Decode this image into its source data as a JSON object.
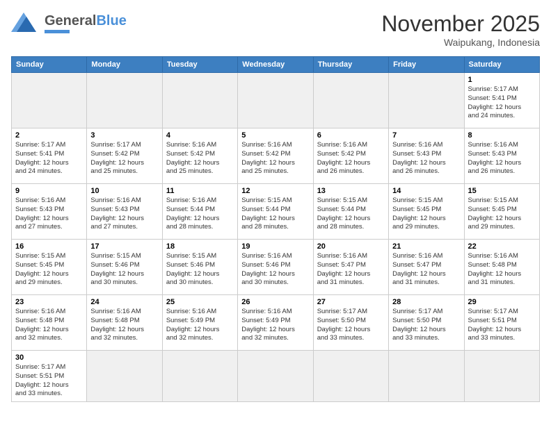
{
  "logo": {
    "text_general": "General",
    "text_blue": "Blue"
  },
  "header": {
    "month": "November 2025",
    "location": "Waipukang, Indonesia"
  },
  "days_of_week": [
    "Sunday",
    "Monday",
    "Tuesday",
    "Wednesday",
    "Thursday",
    "Friday",
    "Saturday"
  ],
  "weeks": [
    [
      {
        "day": "",
        "info": "",
        "empty": true
      },
      {
        "day": "",
        "info": "",
        "empty": true
      },
      {
        "day": "",
        "info": "",
        "empty": true
      },
      {
        "day": "",
        "info": "",
        "empty": true
      },
      {
        "day": "",
        "info": "",
        "empty": true
      },
      {
        "day": "",
        "info": "",
        "empty": true
      },
      {
        "day": "1",
        "info": "Sunrise: 5:17 AM\nSunset: 5:41 PM\nDaylight: 12 hours\nand 24 minutes."
      }
    ],
    [
      {
        "day": "2",
        "info": "Sunrise: 5:17 AM\nSunset: 5:41 PM\nDaylight: 12 hours\nand 24 minutes."
      },
      {
        "day": "3",
        "info": "Sunrise: 5:17 AM\nSunset: 5:42 PM\nDaylight: 12 hours\nand 25 minutes."
      },
      {
        "day": "4",
        "info": "Sunrise: 5:16 AM\nSunset: 5:42 PM\nDaylight: 12 hours\nand 25 minutes."
      },
      {
        "day": "5",
        "info": "Sunrise: 5:16 AM\nSunset: 5:42 PM\nDaylight: 12 hours\nand 25 minutes."
      },
      {
        "day": "6",
        "info": "Sunrise: 5:16 AM\nSunset: 5:42 PM\nDaylight: 12 hours\nand 26 minutes."
      },
      {
        "day": "7",
        "info": "Sunrise: 5:16 AM\nSunset: 5:43 PM\nDaylight: 12 hours\nand 26 minutes."
      },
      {
        "day": "8",
        "info": "Sunrise: 5:16 AM\nSunset: 5:43 PM\nDaylight: 12 hours\nand 26 minutes."
      }
    ],
    [
      {
        "day": "9",
        "info": "Sunrise: 5:16 AM\nSunset: 5:43 PM\nDaylight: 12 hours\nand 27 minutes."
      },
      {
        "day": "10",
        "info": "Sunrise: 5:16 AM\nSunset: 5:43 PM\nDaylight: 12 hours\nand 27 minutes."
      },
      {
        "day": "11",
        "info": "Sunrise: 5:16 AM\nSunset: 5:44 PM\nDaylight: 12 hours\nand 28 minutes."
      },
      {
        "day": "12",
        "info": "Sunrise: 5:15 AM\nSunset: 5:44 PM\nDaylight: 12 hours\nand 28 minutes."
      },
      {
        "day": "13",
        "info": "Sunrise: 5:15 AM\nSunset: 5:44 PM\nDaylight: 12 hours\nand 28 minutes."
      },
      {
        "day": "14",
        "info": "Sunrise: 5:15 AM\nSunset: 5:45 PM\nDaylight: 12 hours\nand 29 minutes."
      },
      {
        "day": "15",
        "info": "Sunrise: 5:15 AM\nSunset: 5:45 PM\nDaylight: 12 hours\nand 29 minutes."
      }
    ],
    [
      {
        "day": "16",
        "info": "Sunrise: 5:15 AM\nSunset: 5:45 PM\nDaylight: 12 hours\nand 29 minutes."
      },
      {
        "day": "17",
        "info": "Sunrise: 5:15 AM\nSunset: 5:46 PM\nDaylight: 12 hours\nand 30 minutes."
      },
      {
        "day": "18",
        "info": "Sunrise: 5:15 AM\nSunset: 5:46 PM\nDaylight: 12 hours\nand 30 minutes."
      },
      {
        "day": "19",
        "info": "Sunrise: 5:16 AM\nSunset: 5:46 PM\nDaylight: 12 hours\nand 30 minutes."
      },
      {
        "day": "20",
        "info": "Sunrise: 5:16 AM\nSunset: 5:47 PM\nDaylight: 12 hours\nand 31 minutes."
      },
      {
        "day": "21",
        "info": "Sunrise: 5:16 AM\nSunset: 5:47 PM\nDaylight: 12 hours\nand 31 minutes."
      },
      {
        "day": "22",
        "info": "Sunrise: 5:16 AM\nSunset: 5:48 PM\nDaylight: 12 hours\nand 31 minutes."
      }
    ],
    [
      {
        "day": "23",
        "info": "Sunrise: 5:16 AM\nSunset: 5:48 PM\nDaylight: 12 hours\nand 32 minutes."
      },
      {
        "day": "24",
        "info": "Sunrise: 5:16 AM\nSunset: 5:48 PM\nDaylight: 12 hours\nand 32 minutes."
      },
      {
        "day": "25",
        "info": "Sunrise: 5:16 AM\nSunset: 5:49 PM\nDaylight: 12 hours\nand 32 minutes."
      },
      {
        "day": "26",
        "info": "Sunrise: 5:16 AM\nSunset: 5:49 PM\nDaylight: 12 hours\nand 32 minutes."
      },
      {
        "day": "27",
        "info": "Sunrise: 5:17 AM\nSunset: 5:50 PM\nDaylight: 12 hours\nand 33 minutes."
      },
      {
        "day": "28",
        "info": "Sunrise: 5:17 AM\nSunset: 5:50 PM\nDaylight: 12 hours\nand 33 minutes."
      },
      {
        "day": "29",
        "info": "Sunrise: 5:17 AM\nSunset: 5:51 PM\nDaylight: 12 hours\nand 33 minutes."
      }
    ],
    [
      {
        "day": "30",
        "info": "Sunrise: 5:17 AM\nSunset: 5:51 PM\nDaylight: 12 hours\nand 33 minutes."
      },
      {
        "day": "",
        "info": "",
        "empty": true
      },
      {
        "day": "",
        "info": "",
        "empty": true
      },
      {
        "day": "",
        "info": "",
        "empty": true
      },
      {
        "day": "",
        "info": "",
        "empty": true
      },
      {
        "day": "",
        "info": "",
        "empty": true
      },
      {
        "day": "",
        "info": "",
        "empty": true
      }
    ]
  ]
}
